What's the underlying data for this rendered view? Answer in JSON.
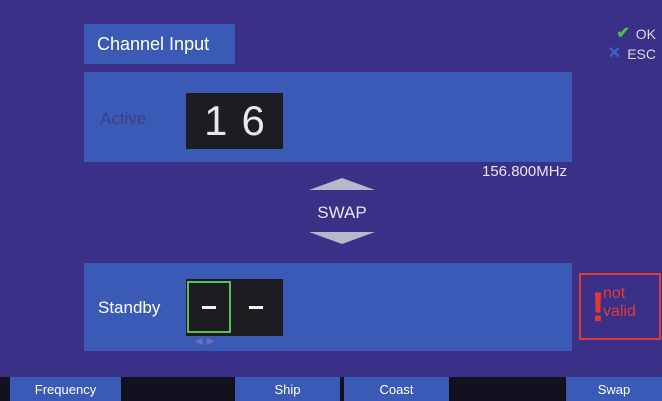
{
  "dialog": {
    "title": "Channel Input",
    "confirm": {
      "ok_label": "OK",
      "esc_label": "ESC"
    }
  },
  "active": {
    "label": "Active",
    "digit1": "1",
    "digit2": "6",
    "frequency": "156.800MHz"
  },
  "swap": {
    "label": "SWAP"
  },
  "standby": {
    "label": "Standby",
    "digit1": "–",
    "digit2": "–",
    "status_line1": "not",
    "status_line2": "valid"
  },
  "softkeys": [
    "Frequency",
    "",
    "Ship",
    "Coast",
    "",
    "Swap"
  ],
  "colors": {
    "background": "#3b3088",
    "panel": "#3b5ab5",
    "digit_box": "#1c1c22",
    "focus": "#58c25a",
    "error": "#e23a2e",
    "ok": "#4fc04a"
  },
  "icons": [
    "check-icon",
    "x-icon",
    "arrow-up-icon",
    "arrow-down-icon",
    "exclamation-icon",
    "left-arrow-icon",
    "right-arrow-icon"
  ]
}
